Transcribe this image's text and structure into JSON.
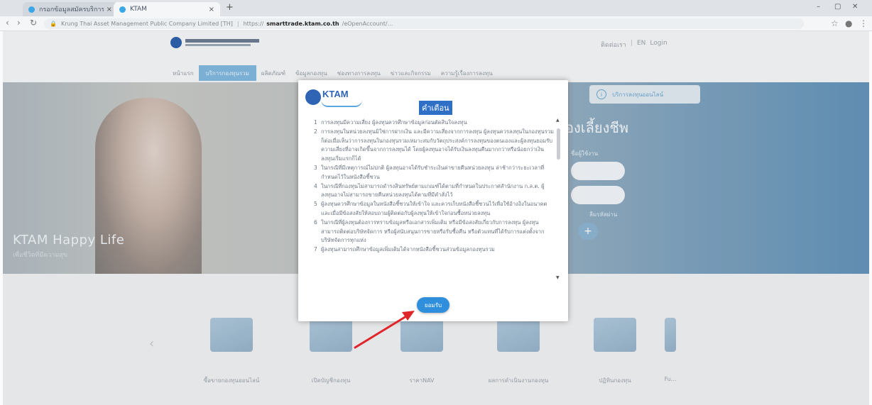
{
  "browser": {
    "tabs": [
      {
        "title": "กรอกข้อมูลสมัครบริการ - KTAM"
      },
      {
        "title": "KTAM"
      }
    ],
    "new_tab": "+",
    "window_controls": [
      "–",
      "▢",
      "✕"
    ],
    "address": {
      "org": "Krung Thai Asset Management Public Company Limited [TH]",
      "scheme": "https://",
      "host": "smarttrade.ktam.co.th",
      "path": "/eOpenAccount/..."
    }
  },
  "header": {
    "logo_text": "บริษัทหลักทรัพย์จัดการกองทุน กรุงไทย จำกัด (มหาชน)",
    "utility": [
      "ติดต่อเรา",
      "|",
      "EN",
      "Login"
    ],
    "nav": [
      "หน้าแรก",
      "บริการกองทุนรวม",
      "ผลิตภัณฑ์",
      "ข้อมูลกองทุน",
      "ช่องทางการลงทุน",
      "ข่าวและกิจกรรม",
      "ความรู้เรื่องการลงทุน"
    ]
  },
  "hero": {
    "title": "KTAM Happy Life",
    "subtitle": "เพื่อชีวิตที่มีความสุข",
    "panel_button": "บริการลงทุนออนไลน์",
    "heading": "องเลี้ยงชีพ",
    "form_label": "ชื่อผู้ใช้งาน",
    "link": "ลืมรหัสผ่าน",
    "plus": "+"
  },
  "services": [
    {
      "label": "ซื้อขายกองทุนออนไลน์"
    },
    {
      "label": "เปิดบัญชีกองทุน"
    },
    {
      "label": "ราคาNAV"
    },
    {
      "label": "ผลการดำเนินงานกองทุน"
    },
    {
      "label": "ปฏิทินกองทุน"
    },
    {
      "label": "Fu..."
    }
  ],
  "modal": {
    "brand": "KTAM",
    "title": "คำเตือน",
    "terms": [
      {
        "num": "1",
        "text": "การลงทุนมีความเสี่ยง ผู้ลงทุนควรศึกษาข้อมูลก่อนตัดสินใจลงทุน"
      },
      {
        "num": "2",
        "text": "การลงทุนในหน่วยลงทุนมิใช่การฝากเงิน และมีความเสี่ยงจากการลงทุน ผู้ลงทุนควรลงทุนในกองทุนรวม ก็ต่อเมื่อเห็นว่าการลงทุนในกองทุนรวมเหมาะสมกับวัตถุประสงค์การลงทุนของตนเองและผู้ลงทุนยอมรับความเสี่ยงที่อาจเกิดขึ้นจากการลงทุนได้ โดยผู้ลงทุนอาจได้รับเงินลงทุนคืนมากกว่าหรือน้อยกว่าเงินลงทุนเริ่มแรกก็ได้"
      },
      {
        "num": "3",
        "text": "ในกรณีที่มีเหตุการณ์ไม่ปกติ ผู้ลงทุนอาจได้รับชำระเงินค่าขายคืนหน่วยลงทุน ล่าช้ากว่าระยะเวลาที่กำหนดไว้ในหนังสือชี้ชวน"
      },
      {
        "num": "4",
        "text": "ในกรณีที่กองทุนไม่สามารถดำรงสินทรัพย์ตามเกณฑ์ได้ตามที่กำหนดในประกาศสำนักงาน ก.ล.ต. ผู้ลงทุนอาจไม่สามารถขายคืนหน่วยลงทุนได้ตามที่มีคำสั่งไว้"
      },
      {
        "num": "5",
        "text": "ผู้ลงทุนควรศึกษาข้อมูลในหนังสือชี้ชวนให้เข้าใจ และควรเก็บหนังสือชี้ชวนไว้เพื่อใช้อ้างอิงในอนาคต และเมื่อมีข้อสงสัยให้สอบถามผู้ติดต่อกับผู้ลงทุนให้เข้าใจก่อนซื้อหน่วยลงทุน"
      },
      {
        "num": "6",
        "text": "ในกรณีที่ผู้ลงทุนต้องการทราบข้อมูลหรือเอกสารเพิ่มเติม หรือมีข้อสงสัยเกี่ยวกับการลงทุน ผู้ลงทุนสามารถติดต่อบริษัทจัดการ หรือผู้สนับสนุนการขายหรือรับซื้อคืน หรือตัวแทนที่ได้รับการแต่งตั้งจากบริษัทจัดการทุกแห่ง"
      },
      {
        "num": "7",
        "text": "ผู้ลงทุนสามารถศึกษาข้อมูลเพิ่มเติมได้จากหนังสือชี้ชวนส่วนข้อมูลกองทุนรวม"
      }
    ],
    "accept_button": "ยอมรับ"
  }
}
